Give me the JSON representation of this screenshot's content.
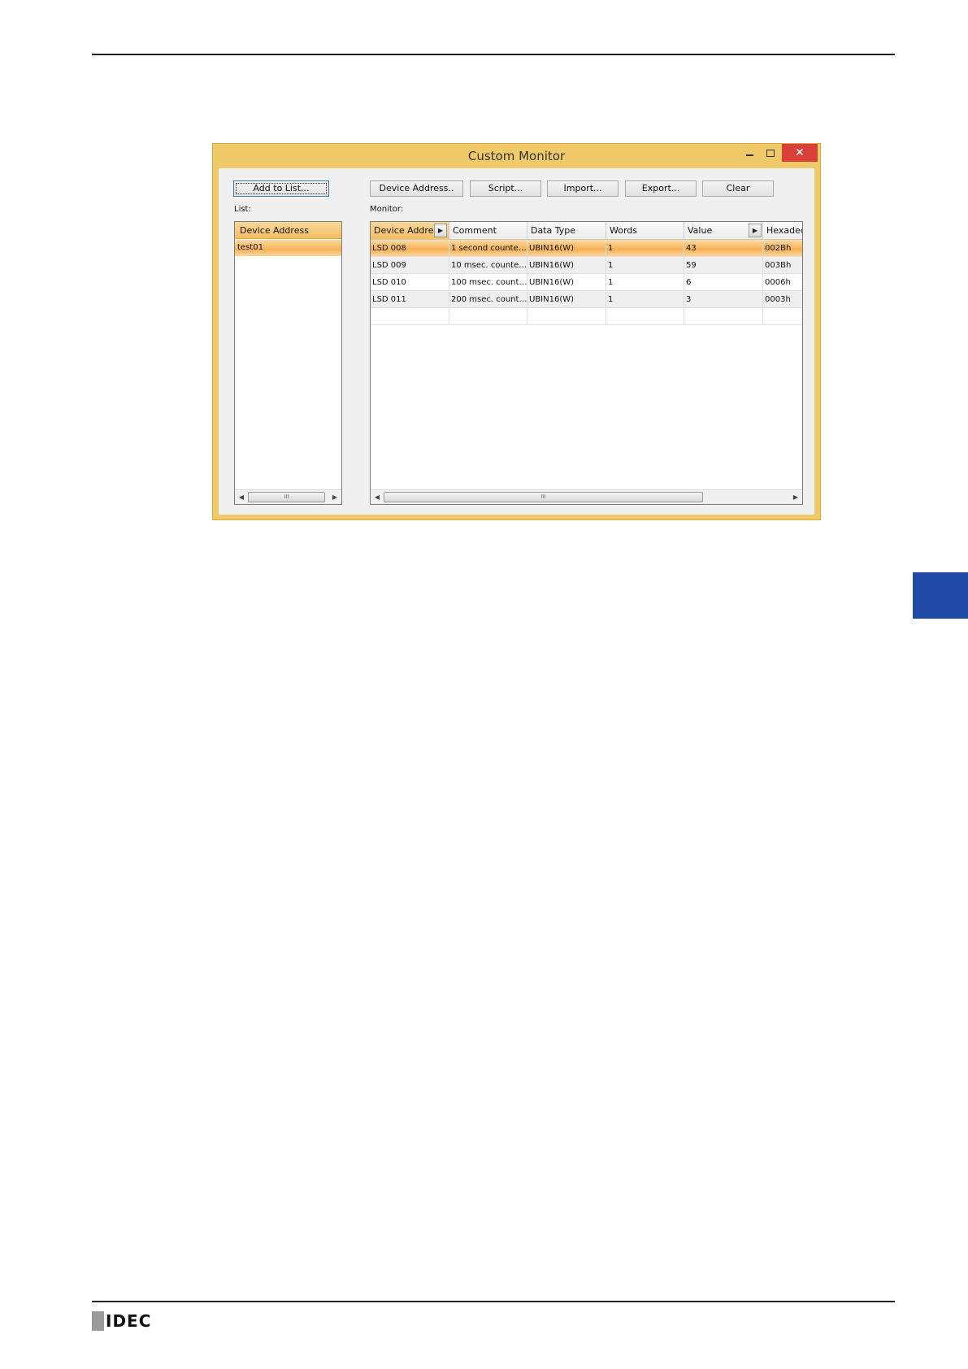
{
  "window": {
    "title": "Custom Monitor",
    "close_glyph": "✕"
  },
  "toolbar": {
    "add_to_list": "Add to List...",
    "device_address": "Device Address..",
    "script": "Script...",
    "import": "Import...",
    "export": "Export...",
    "clear": "Clear"
  },
  "list": {
    "label": "List:",
    "header": "Device Address",
    "items": [
      "test01"
    ]
  },
  "monitor": {
    "label": "Monitor:",
    "columns": [
      "Device Address",
      "Comment",
      "Data Type",
      "Words",
      "Value",
      "Hexadecir"
    ],
    "rows": [
      [
        "LSD 008",
        "1 second counte…",
        "UBIN16(W)",
        "1",
        "43",
        "002Bh"
      ],
      [
        "LSD 009",
        "10 msec. counte…",
        "UBIN16(W)",
        "1",
        "59",
        "003Bh"
      ],
      [
        "LSD 010",
        "100 msec. count…",
        "UBIN16(W)",
        "1",
        "6",
        "0006h"
      ],
      [
        "LSD 011",
        "200 msec. count…",
        "UBIN16(W)",
        "1",
        "3",
        "0003h"
      ]
    ]
  },
  "scrollbar": {
    "left_arrow": "◀",
    "right_arrow": "▶",
    "grip": "III"
  },
  "header_arrow": "▶",
  "footer": {
    "logo_text": "IDEC"
  },
  "colors": {
    "window_frame": "#f0c969",
    "selection": "#f6b055",
    "close_button": "#d9403a",
    "side_tab": "#1f4aa8"
  }
}
